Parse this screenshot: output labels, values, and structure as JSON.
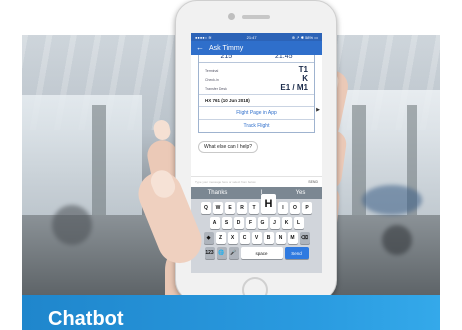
{
  "caption": {
    "title": "Chatbot"
  },
  "phone": {
    "status_bar": {
      "left": "●●●●○ ≋",
      "time": "21:47",
      "right": "⊕ ↗ ✱ 58% ▭"
    },
    "app_bar": {
      "back_icon": "back-arrow-icon",
      "title": "Ask Timmy"
    },
    "flight_card": {
      "times": [
        "215",
        "21:45"
      ],
      "rows": [
        {
          "label": "Terminal",
          "value": "T1"
        },
        {
          "label": "Check-in",
          "value": "K"
        },
        {
          "label": "Transfer Desk",
          "value": "E1 / M1"
        }
      ],
      "flight": "HX 761 (10 Jun 2018)",
      "links": [
        "Flight Page in App",
        "Track Flight"
      ]
    },
    "bot_message": "What else can I help?",
    "input": {
      "placeholder": "Type your message here or select from below",
      "send": "SEND"
    },
    "keyboard": {
      "suggestions": [
        "Thanks",
        "I",
        "Yes"
      ],
      "row1": [
        "Q",
        "W",
        "E",
        "R",
        "T",
        "H",
        "I",
        "O",
        "P"
      ],
      "row2": [
        "A",
        "S",
        "D",
        "F",
        "G",
        "J",
        "K",
        "L"
      ],
      "row3": [
        "◆",
        "Z",
        "X",
        "C",
        "V",
        "B",
        "N",
        "M",
        "⌫"
      ],
      "row4": {
        "num": "123",
        "globe": "🌐",
        "mic": "🎤",
        "space": "space",
        "send": "Send"
      }
    }
  }
}
